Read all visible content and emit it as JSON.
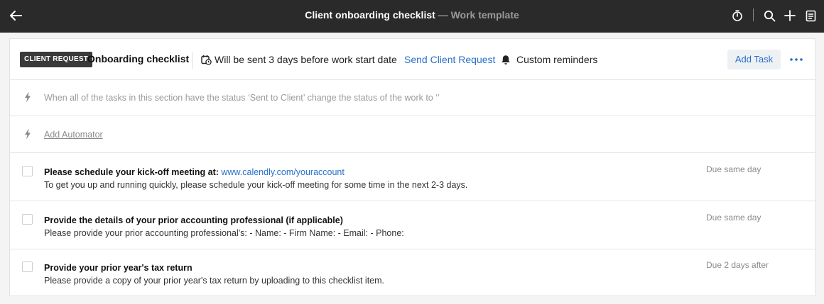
{
  "topbar": {
    "title": "Client onboarding checklist",
    "separator": " — ",
    "subtitle": "Work template",
    "icons": [
      "back-arrow-icon",
      "timer-icon",
      "search-icon",
      "plus-icon",
      "document-icon"
    ]
  },
  "section": {
    "badge": "CLIENT REQUEST",
    "title": "Onboarding checklist",
    "send_info": "Will be sent 3 days before work start date",
    "send_link": "Send Client Request",
    "reminders": "Custom reminders",
    "add_task": "Add Task"
  },
  "automations": {
    "rule_text": "When all of the tasks in this section have the status ‘Sent to Client’ change the status of the work to ‘’",
    "add_label": "Add Automator"
  },
  "tasks": [
    {
      "title": "Please schedule your kick-off meeting at: ",
      "link": "www.calendly.com/youraccount",
      "description": "To get you up and running quickly, please schedule your kick-off meeting for some time in the next 2-3 days.",
      "due": "Due same day"
    },
    {
      "title": "Provide the details of your prior accounting professional (if applicable)",
      "description": "Please provide your prior accounting professional's: - Name: - Firm Name: - Email: - Phone:",
      "due": "Due same day"
    },
    {
      "title": "Provide your prior year's tax return",
      "description": "Please provide a copy of your prior year's tax return by uploading to this checklist item.",
      "due": "Due 2 days after"
    }
  ],
  "colors": {
    "topbar_bg": "#2a2a2a",
    "link": "#2a6fc9",
    "badge_bg": "#3a3a3a"
  }
}
